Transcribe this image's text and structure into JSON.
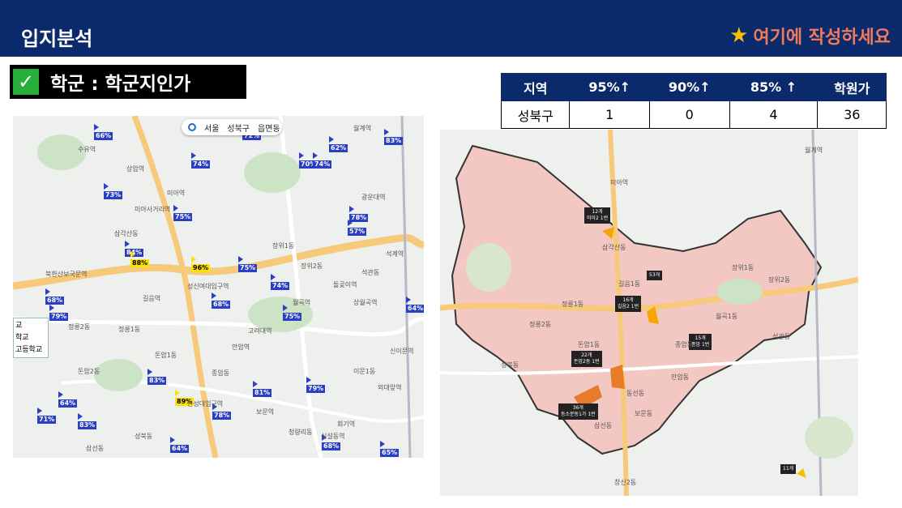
{
  "header": {
    "title": "입지분석",
    "note_star": "★",
    "note_text": "여기에 작성하세요"
  },
  "section": {
    "check": "✓",
    "title": "학군 : 학군지인가"
  },
  "stats_table": {
    "headers": [
      "지역",
      "95%↑",
      "90%↑",
      "85% ↑",
      "학원가"
    ],
    "rows": [
      [
        "성북구",
        "1",
        "0",
        "4",
        "36"
      ]
    ]
  },
  "map1": {
    "chips": [
      "서울",
      "성북구",
      "읍면동"
    ],
    "legend": [
      "교",
      "학교",
      "고등학교"
    ],
    "markers": [
      {
        "text": "66%",
        "color": "blue"
      },
      {
        "text": "72%",
        "color": "blue"
      },
      {
        "text": "74%",
        "color": "blue"
      },
      {
        "text": "73%",
        "color": "blue"
      },
      {
        "text": "75%",
        "color": "blue"
      },
      {
        "text": "84%",
        "color": "blue"
      },
      {
        "text": "88%",
        "color": "yellow"
      },
      {
        "text": "96%",
        "color": "yellow"
      },
      {
        "text": "75%",
        "color": "blue"
      },
      {
        "text": "74%",
        "color": "blue"
      },
      {
        "text": "68%",
        "color": "blue"
      },
      {
        "text": "79%",
        "color": "blue"
      },
      {
        "text": "68%",
        "color": "blue"
      },
      {
        "text": "75%",
        "color": "blue"
      },
      {
        "text": "78%",
        "color": "blue"
      },
      {
        "text": "57%",
        "color": "blue"
      },
      {
        "text": "83%",
        "color": "blue"
      },
      {
        "text": "62%",
        "color": "blue"
      },
      {
        "text": "70%",
        "color": "blue"
      },
      {
        "text": "74%",
        "color": "blue"
      },
      {
        "text": "64%",
        "color": "blue"
      },
      {
        "text": "83%",
        "color": "blue"
      },
      {
        "text": "89%",
        "color": "yellow"
      },
      {
        "text": "78%",
        "color": "blue"
      },
      {
        "text": "81%",
        "color": "blue"
      },
      {
        "text": "79%",
        "color": "blue"
      },
      {
        "text": "64%",
        "color": "blue"
      },
      {
        "text": "71%",
        "color": "blue"
      },
      {
        "text": "83%",
        "color": "blue"
      },
      {
        "text": "64%",
        "color": "blue"
      },
      {
        "text": "68%",
        "color": "blue"
      },
      {
        "text": "65%",
        "color": "blue"
      }
    ],
    "places": [
      "수유역",
      "상암역",
      "미아역",
      "미아사거리역",
      "성신여대입구역",
      "한성대입구역",
      "삼각산동",
      "길음역",
      "정릉1동",
      "정릉2동",
      "돈암1동",
      "돈암2동",
      "종암동",
      "안암역",
      "보문역",
      "장위1동",
      "장위2동",
      "석관동",
      "돌곶이역",
      "월곡역",
      "상월곡역",
      "고려대역",
      "신설동역",
      "성북동",
      "삼선동",
      "북한산보국문역",
      "월계역",
      "광운대역",
      "석계역",
      "이문1동",
      "청량리동",
      "외대앞역",
      "회기역",
      "신이문역"
    ]
  },
  "map2": {
    "tags": [
      {
        "line1": "12개",
        "line2": "미아2 1번"
      },
      {
        "line1": "53개",
        "line2": ""
      },
      {
        "line1": "16개",
        "line2": "길음2 1번"
      },
      {
        "line1": "15개",
        "line2": "종암 1번"
      },
      {
        "line1": "22개",
        "line2": "돈암2동 1번"
      },
      {
        "line1": "36개",
        "line2": "동소문동1가 1번"
      },
      {
        "line1": "11개",
        "line2": ""
      }
    ],
    "places": [
      "미아역",
      "장위1동",
      "장위2동",
      "석관동",
      "월곡1동",
      "종암동",
      "길음1동",
      "정릉1동",
      "정릉2동",
      "성북동",
      "삼선동",
      "보문동",
      "안암동",
      "동선동",
      "돈암1동",
      "삼각산동",
      "창신2동",
      "월계역"
    ]
  },
  "colors": {
    "header_bg": "#0b2a6b",
    "note_text": "#f2795a",
    "star": "#f2c200",
    "check_bg": "#27ae3b",
    "marker_blue": "#2a3fc4",
    "marker_yellow": "#ffe100",
    "district_fill": "#f3c7c2"
  }
}
